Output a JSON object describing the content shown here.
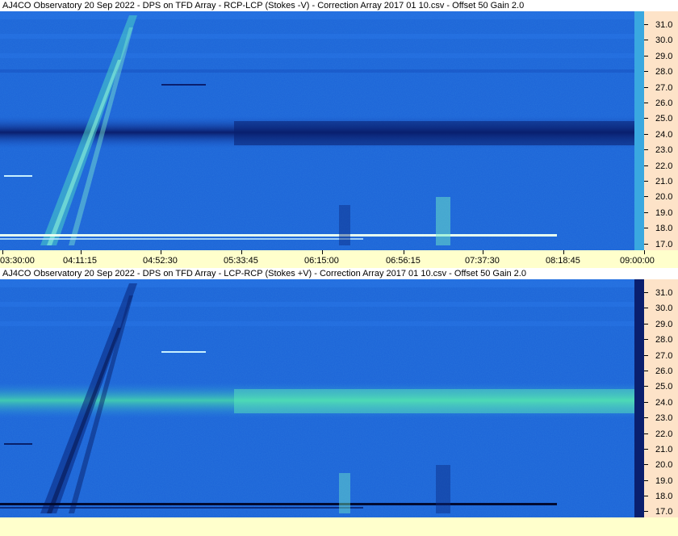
{
  "chart_data": [
    {
      "type": "heatmap",
      "title": "AJ4CO Observatory 20 Sep 2022  -  DPS on TFD Array  -  RCP-LCP (Stokes -V)  -  Correction Array 2017 01 10.csv  -  Offset 50  Gain 2.0",
      "x_tick_labels": [
        "03:30:00",
        "04:11:15",
        "04:52:30",
        "05:33:45",
        "06:15:00",
        "06:56:15",
        "07:37:30",
        "08:18:45",
        "09:00:00"
      ],
      "y_tick_labels": [
        "31.0",
        "30.0",
        "29.0",
        "28.0",
        "27.0",
        "26.0",
        "25.0",
        "24.0",
        "23.0",
        "22.0",
        "21.0",
        "20.0",
        "19.0",
        "18.0",
        "17.0"
      ],
      "ylim": [
        16.5,
        31.8
      ],
      "colors": {
        "background": "#1c63d8",
        "dark_band": "#0a1f6e",
        "bright": "#6ef0c8"
      }
    },
    {
      "type": "heatmap",
      "title": "AJ4CO Observatory 20 Sep 2022  -  DPS on TFD Array  -  LCP-RCP (Stokes +V)  -  Correction Array 2017 01 10.csv  -  Offset 50  Gain 2.0",
      "y_tick_labels": [
        "31.0",
        "30.0",
        "29.0",
        "28.0",
        "27.0",
        "26.0",
        "25.0",
        "24.0",
        "23.0",
        "22.0",
        "21.0",
        "20.0",
        "19.0",
        "18.0",
        "17.0"
      ],
      "ylim": [
        16.5,
        31.8
      ],
      "colors": {
        "background": "#1c63d8",
        "bright_band": "#48e0a8",
        "dark": "#0a1f6e"
      }
    }
  ]
}
